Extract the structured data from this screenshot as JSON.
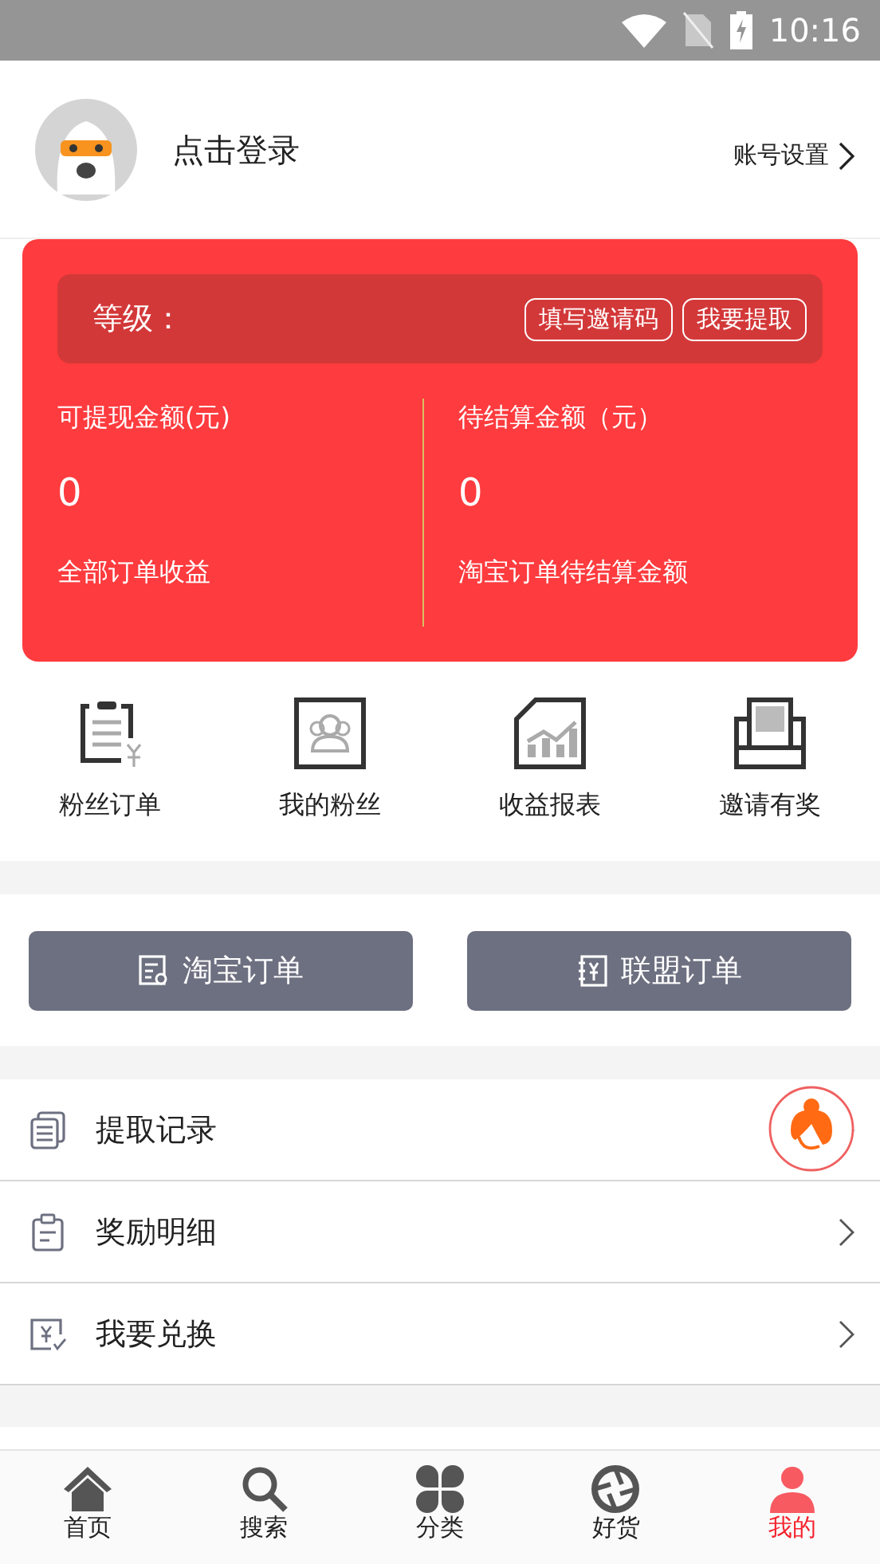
{
  "status_bar": {
    "time": "10:16"
  },
  "profile": {
    "login": "点击登录",
    "settings": "账号设置"
  },
  "earnings": {
    "level_label": "等级：",
    "buttons": [
      "填写邀请码",
      "我要提取"
    ],
    "columns": [
      {
        "label": "可提现金额(元)",
        "value": "0",
        "caption": "全部订单收益"
      },
      {
        "label": "待结算金额（元）",
        "value": "0",
        "caption": "淘宝订单待结算金额"
      }
    ]
  },
  "shortcuts": [
    {
      "kind": "fan_orders",
      "label": "粉丝订单"
    },
    {
      "kind": "fans",
      "label": "我的粉丝"
    },
    {
      "kind": "report",
      "label": "收益报表"
    },
    {
      "kind": "invite",
      "label": "邀请有奖"
    }
  ],
  "order_buttons": [
    {
      "kind": "taobao",
      "label": "淘宝订单"
    },
    {
      "kind": "alliance",
      "label": "联盟订单"
    }
  ],
  "menu": [
    {
      "kind": "records",
      "label": "提取记录"
    },
    {
      "kind": "rewards",
      "label": "奖励明细"
    },
    {
      "kind": "exchange",
      "label": "我要兑换"
    }
  ],
  "tab_bar": [
    {
      "kind": "home",
      "label": "首页",
      "selected": false
    },
    {
      "kind": "search",
      "label": "搜索",
      "selected": false
    },
    {
      "kind": "category",
      "label": "分类",
      "selected": false
    },
    {
      "kind": "goods",
      "label": "好货",
      "selected": false
    },
    {
      "kind": "me",
      "label": "我的",
      "selected": true
    }
  ]
}
